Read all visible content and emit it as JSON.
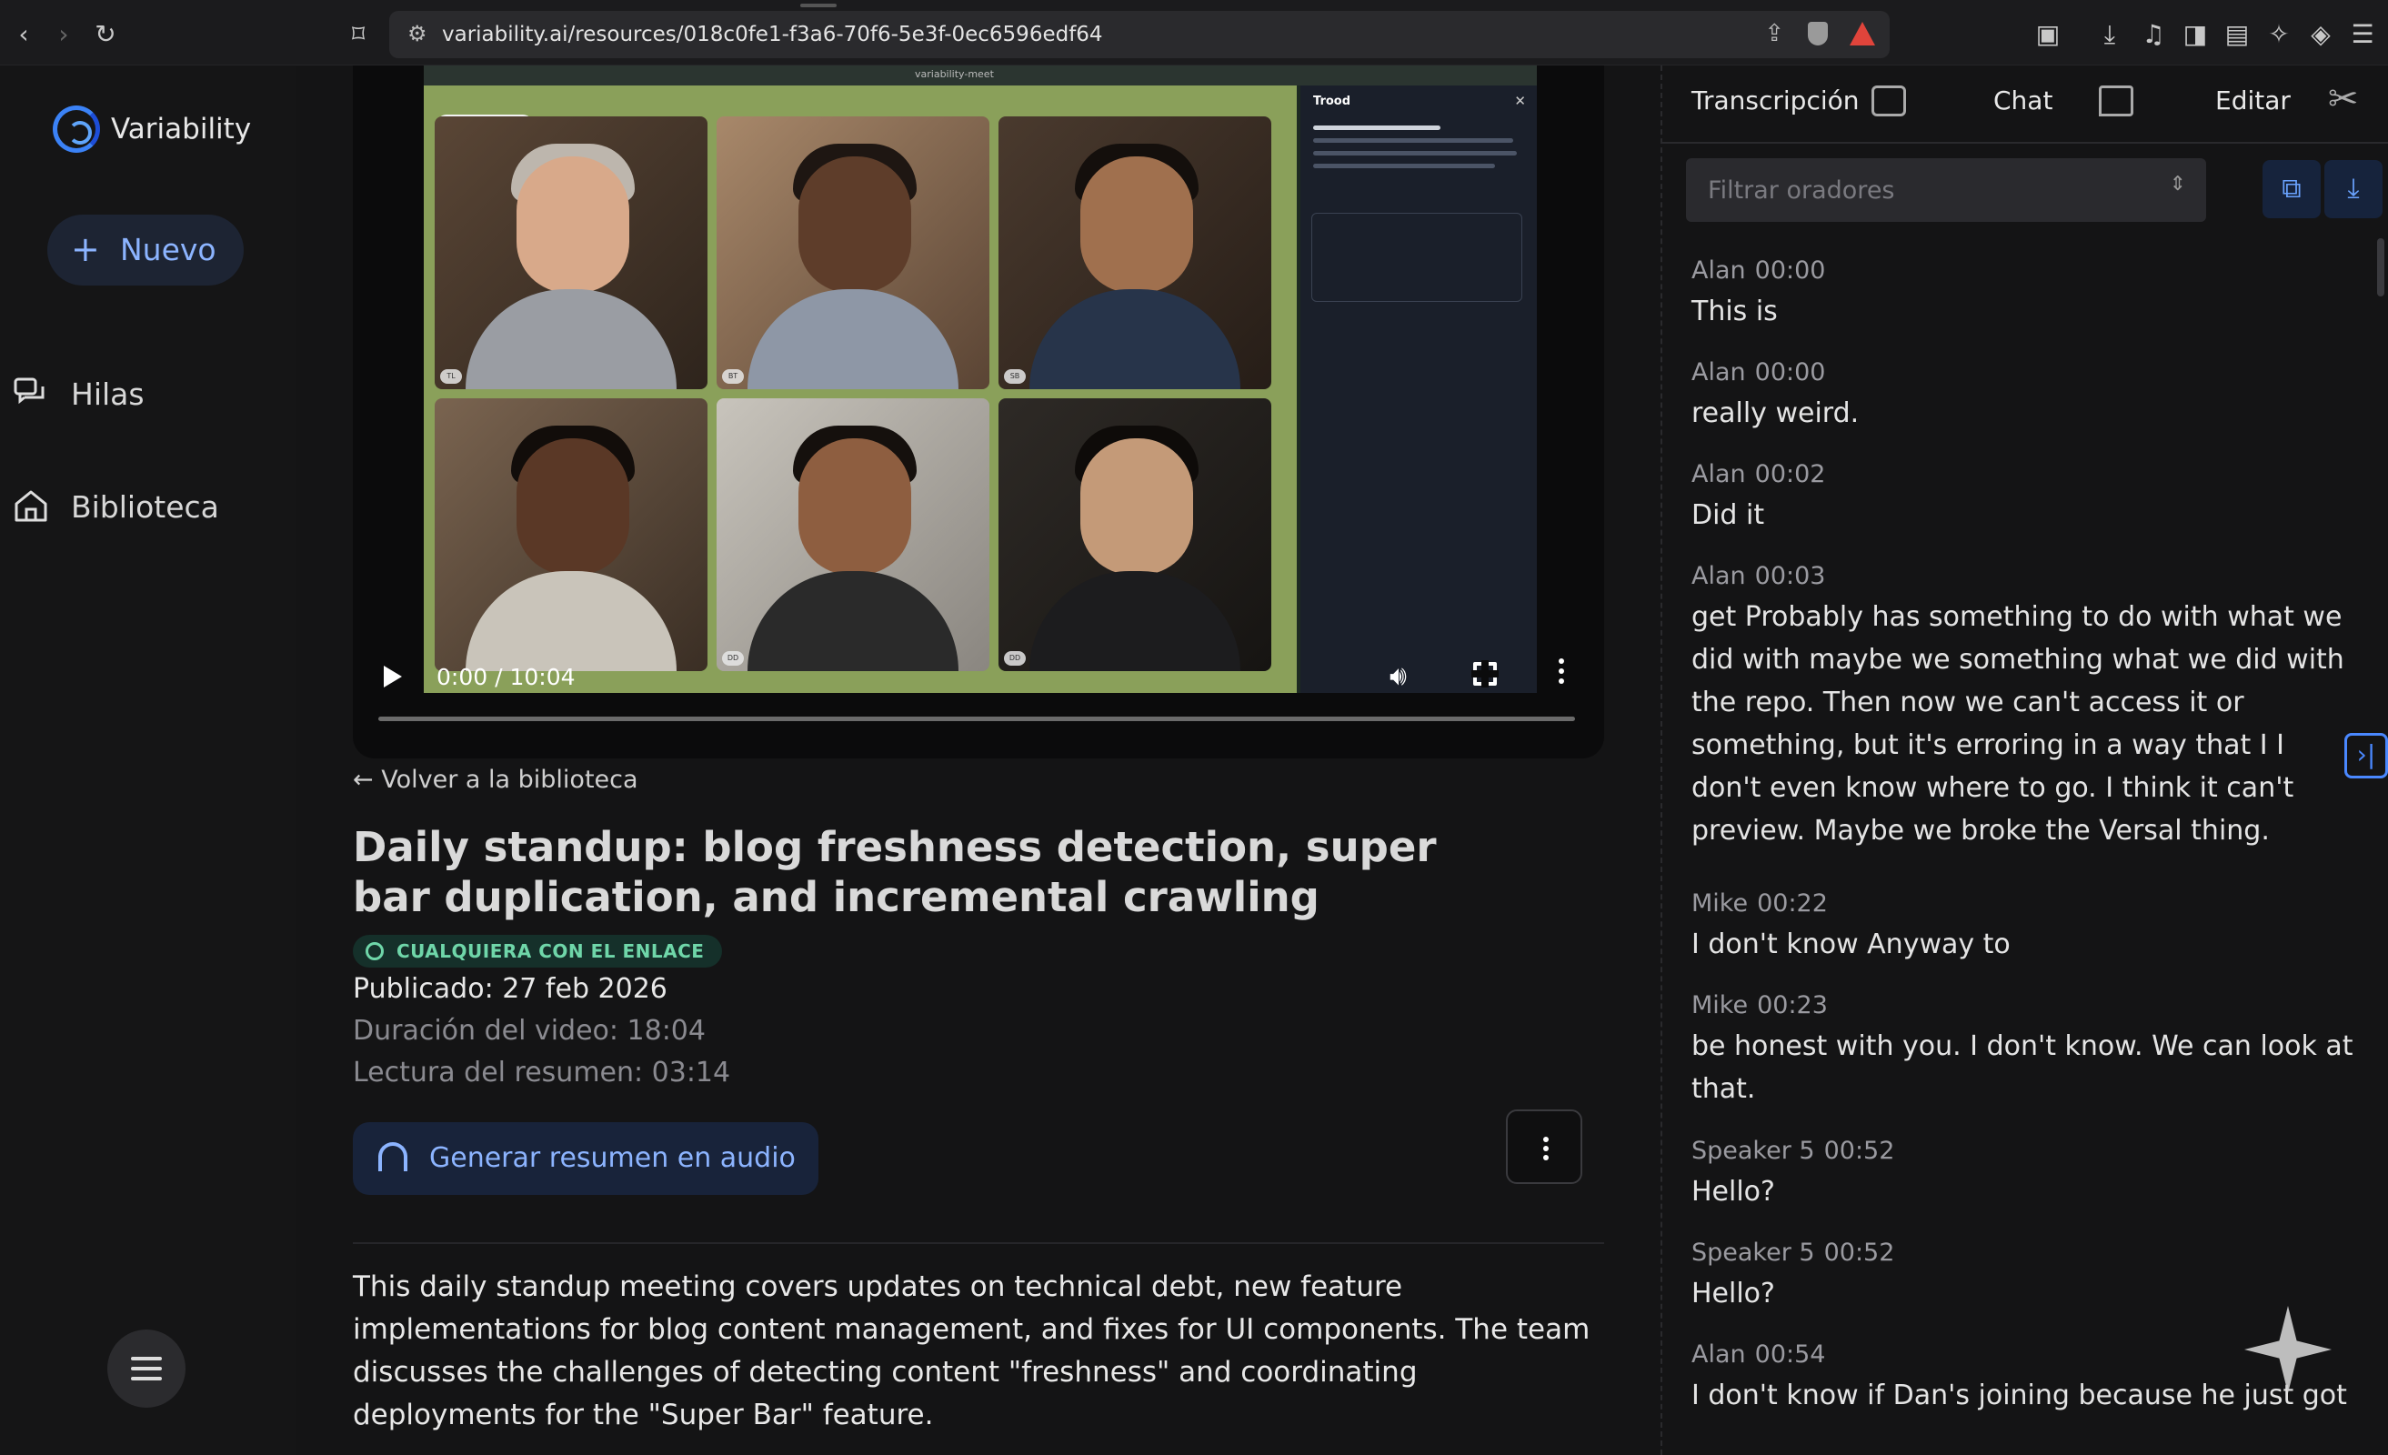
{
  "browser": {
    "url": "variability.ai/resources/018c0fe1-f3a6-70f6-5e3f-0ec6596edf64"
  },
  "sidebar": {
    "logo": "Variability",
    "new_button": "Nuevo",
    "items": [
      {
        "label": "Hilas",
        "icon": "threads-icon"
      },
      {
        "label": "Biblioteca",
        "icon": "home-icon"
      }
    ]
  },
  "video": {
    "time": "0:00 / 10:04",
    "progress_fraction": 0.0,
    "preview_app_title": "variability-meet",
    "preview_panel_title": "Trood"
  },
  "content": {
    "back_link": "Volver a la biblioteca",
    "title": "Daily standup: blog freshness detection, super bar duplication, and incremental crawling",
    "share_badge": "CUALQUIERA CON EL ENLACE",
    "published": "Publicado: 27 feb 2026",
    "duration": "Duración del video: 18:04",
    "reading": "Lectura del resumen: 03:14",
    "audio_button": "Generar resumen en audio",
    "summary": "This daily standup meeting covers updates on technical debt, new feature implementations for blog content management, and fixes for UI components. The team discusses the challenges of detecting content \"freshness\" and coordinating deployments for the \"Super Bar\" feature."
  },
  "panel": {
    "tabs": [
      {
        "label": "Transcripción",
        "icon": "transcript-icon"
      },
      {
        "label": "Chat",
        "icon": "chat-bubble-icon"
      },
      {
        "label": "Editar",
        "icon": "scissors-icon"
      }
    ],
    "filter_placeholder": "Filtrar oradores",
    "transcript": [
      {
        "speaker": "Alan",
        "time": "00:00",
        "text": "This is"
      },
      {
        "speaker": "Alan",
        "time": "00:00",
        "text": "really weird."
      },
      {
        "speaker": "Alan",
        "time": "00:02",
        "text": "Did it"
      },
      {
        "speaker": "Alan",
        "time": "00:03",
        "text": "get Probably has something to do with what we did with maybe we something what we did with the repo. Then now we can't access it or something, but it's erroring in a way that I I don't even know where to go. I think it can't preview. Maybe we broke the Versal thing."
      },
      {
        "speaker": "Mike",
        "time": "00:22",
        "text": "I don't know Anyway to"
      },
      {
        "speaker": "Mike",
        "time": "00:23",
        "text": "be honest with you. I don't know. We can look at that."
      },
      {
        "speaker": "Speaker 5",
        "time": "00:52",
        "text": "Hello?"
      },
      {
        "speaker": "Speaker 5",
        "time": "00:52",
        "text": "Hello?"
      },
      {
        "speaker": "Alan",
        "time": "00:54",
        "text": "I don't know if Dan's joining because he just got"
      }
    ]
  },
  "colors": {
    "accent": "#8cb4ff",
    "badge_green": "#6fd6a9",
    "background": "#141415"
  }
}
